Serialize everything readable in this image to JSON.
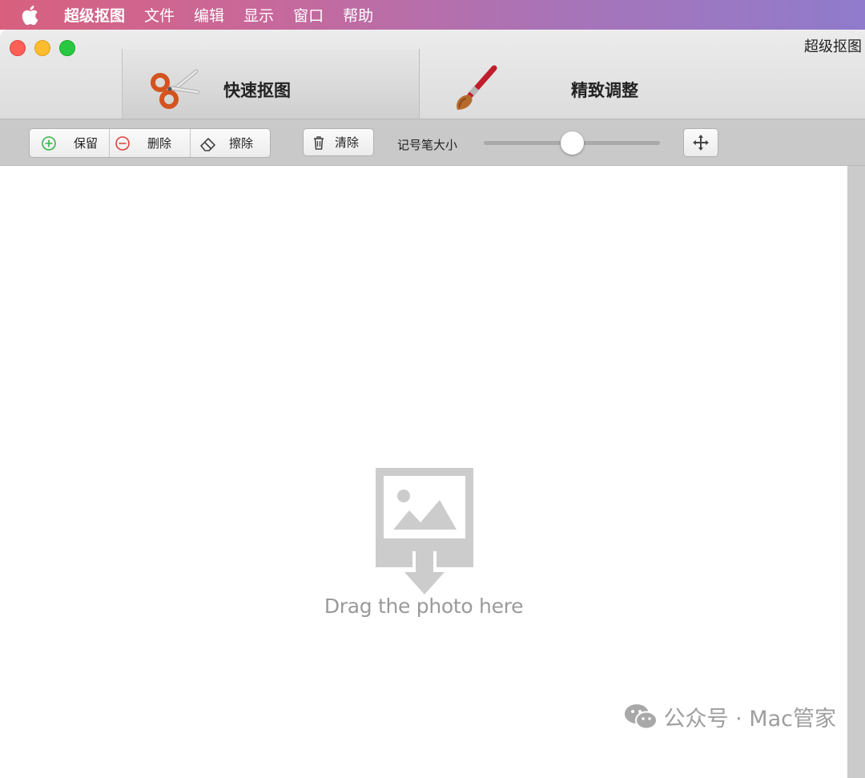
{
  "menubar": {
    "app_name": "超级抠图",
    "items": [
      "文件",
      "编辑",
      "显示",
      "窗口",
      "帮助"
    ]
  },
  "window": {
    "title": "超级抠图"
  },
  "tabs": [
    {
      "label": "快速抠图",
      "icon": "scissors-icon"
    },
    {
      "label": "精致调整",
      "icon": "paintbrush-icon"
    }
  ],
  "toolbar": {
    "keep_label": "保留",
    "delete_label": "删除",
    "erase_label": "擦除",
    "clear_label": "清除",
    "marker_size_label": "记号笔大小",
    "marker_size_value": 0.5
  },
  "canvas": {
    "drop_hint": "Drag the photo here"
  },
  "watermark": {
    "text": "公众号 · Mac管家"
  },
  "colors": {
    "keep_green": "#36b34a",
    "delete_red": "#e0413a",
    "placeholder_gray": "#cccccc"
  }
}
